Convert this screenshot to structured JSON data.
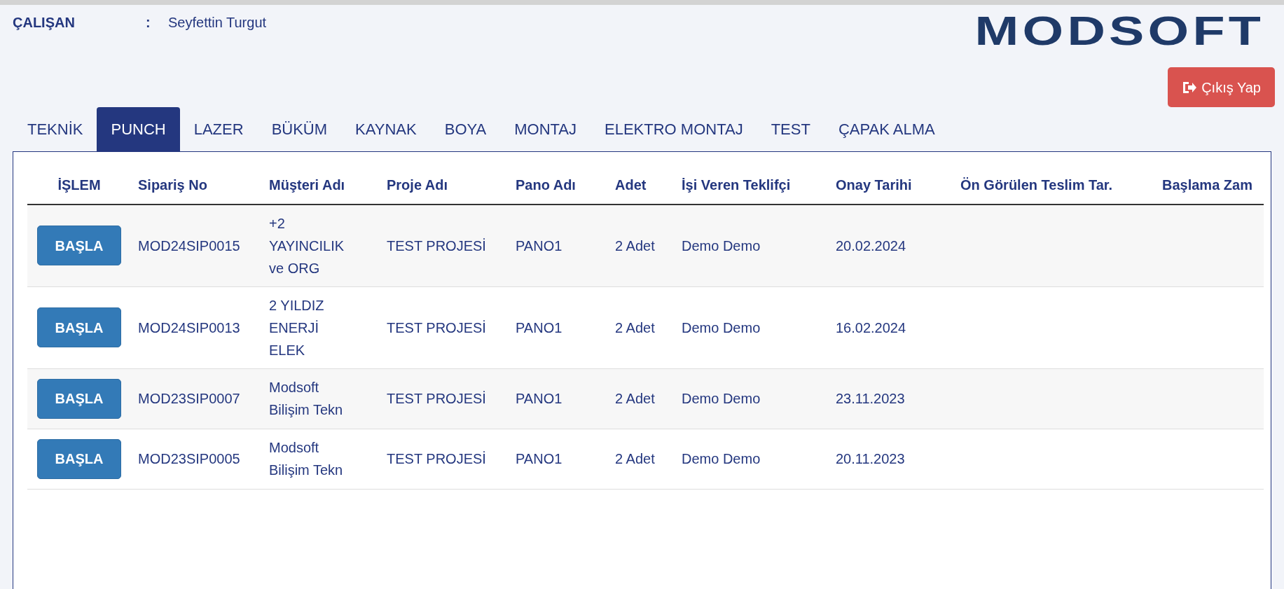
{
  "employee": {
    "label": "ÇALIŞAN",
    "separator": ":",
    "name": "Seyfettin Turgut"
  },
  "logo": "MODSOFT",
  "logout_button": "Çıkış Yap",
  "tabs": [
    {
      "label": "TEKNİK",
      "selected": false
    },
    {
      "label": "PUNCH",
      "selected": true
    },
    {
      "label": "LAZER",
      "selected": false
    },
    {
      "label": "BÜKÜM",
      "selected": false
    },
    {
      "label": "KAYNAK",
      "selected": false
    },
    {
      "label": "BOYA",
      "selected": false
    },
    {
      "label": "MONTAJ",
      "selected": false
    },
    {
      "label": "ELEKTRO MONTAJ",
      "selected": false
    },
    {
      "label": "TEST",
      "selected": false
    },
    {
      "label": "ÇAPAK ALMA",
      "selected": false
    }
  ],
  "table": {
    "columns": [
      "İŞLEM",
      "Sipariş No",
      "Müşteri Adı",
      "Proje Adı",
      "Pano Adı",
      "Adet",
      "İşi Veren Teklifçi",
      "Onay Tarihi",
      "Ön Görülen Teslim Tar.",
      "Başlama Zam"
    ],
    "rows": [
      {
        "cells": [
          "BAŞLA",
          "MOD24SIP0015",
          "+2 YAYINCILIK ve ORG",
          "TEST PROJESİ",
          "PANO1",
          "2 Adet",
          "Demo Demo",
          "20.02.2024"
        ]
      },
      {
        "cells": [
          "BAŞLA",
          "MOD24SIP0013",
          "2 YILDIZ ENERJİ ELEK",
          "TEST PROJESİ",
          "PANO1",
          "2 Adet",
          "Demo Demo",
          "16.02.2024"
        ]
      },
      {
        "cells": [
          "BAŞLA",
          "MOD23SIP0007",
          "Modsoft Bilişim Tekn",
          "TEST PROJESİ",
          "PANO1",
          "2 Adet",
          "Demo Demo",
          "23.11.2023"
        ]
      },
      {
        "cells": [
          "BAŞLA",
          "MOD23SIP0005",
          "Modsoft Bilişim Tekn",
          "TEST PROJESİ",
          "PANO1",
          "2 Adet",
          "Demo Demo",
          "20.11.2023"
        ]
      }
    ]
  }
}
